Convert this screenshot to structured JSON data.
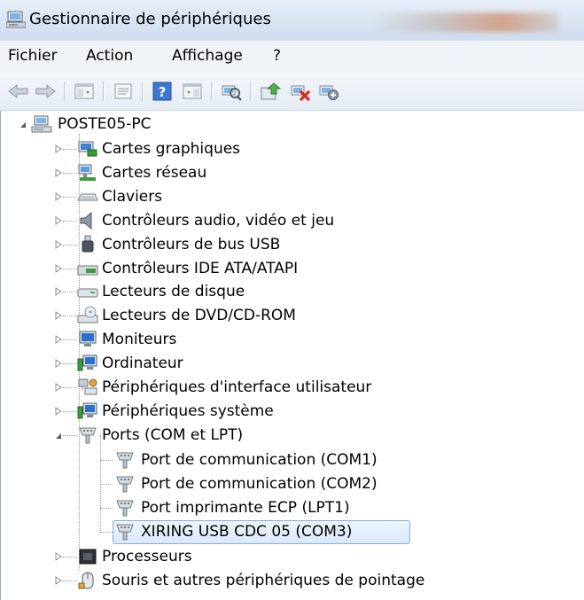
{
  "window": {
    "title": "Gestionnaire de périphériques",
    "icon": "device-manager-icon"
  },
  "menu": {
    "items": [
      "Fichier",
      "Action",
      "Affichage",
      "?"
    ]
  },
  "toolbar": {
    "buttons": [
      {
        "name": "back-arrow-icon"
      },
      {
        "name": "forward-arrow-icon"
      },
      {
        "name": "console-tree-icon"
      },
      {
        "name": "properties-icon"
      },
      {
        "name": "help-icon",
        "glyph": "?"
      },
      {
        "name": "action-pane-icon"
      },
      {
        "name": "scan-hardware-icon"
      },
      {
        "name": "update-driver-icon"
      },
      {
        "name": "uninstall-icon"
      },
      {
        "name": "disable-device-icon"
      }
    ]
  },
  "tree": {
    "root": "POSTE05-PC",
    "categories": [
      {
        "label": "Cartes graphiques",
        "icon": "display-adapter-icon"
      },
      {
        "label": "Cartes réseau",
        "icon": "network-adapter-icon"
      },
      {
        "label": "Claviers",
        "icon": "keyboard-icon"
      },
      {
        "label": "Contrôleurs audio, vidéo et jeu",
        "icon": "speaker-icon"
      },
      {
        "label": "Contrôleurs de bus USB",
        "icon": "usb-plug-icon"
      },
      {
        "label": "Contrôleurs IDE ATA/ATAPI",
        "icon": "ide-controller-icon"
      },
      {
        "label": "Lecteurs de disque",
        "icon": "disk-drive-icon"
      },
      {
        "label": "Lecteurs de DVD/CD-ROM",
        "icon": "dvd-drive-icon"
      },
      {
        "label": "Moniteurs",
        "icon": "monitor-icon"
      },
      {
        "label": "Ordinateur",
        "icon": "computer-icon"
      },
      {
        "label": "Périphériques d'interface utilisateur",
        "icon": "hid-icon"
      },
      {
        "label": "Périphériques système",
        "icon": "system-device-icon"
      }
    ],
    "ports": {
      "label": "Ports (COM et LPT)",
      "icon": "port-connector-icon",
      "children": [
        "Port de communication (COM1)",
        "Port de communication (COM2)",
        "Port imprimante ECP (LPT1)",
        "XIRING USB CDC 05 (COM3)"
      ],
      "selected": "XIRING USB CDC 05 (COM3)"
    },
    "after": [
      {
        "label": "Processeurs",
        "icon": "processor-icon"
      },
      {
        "label": "Souris et autres périphériques de pointage",
        "icon": "mouse-icon"
      }
    ]
  }
}
